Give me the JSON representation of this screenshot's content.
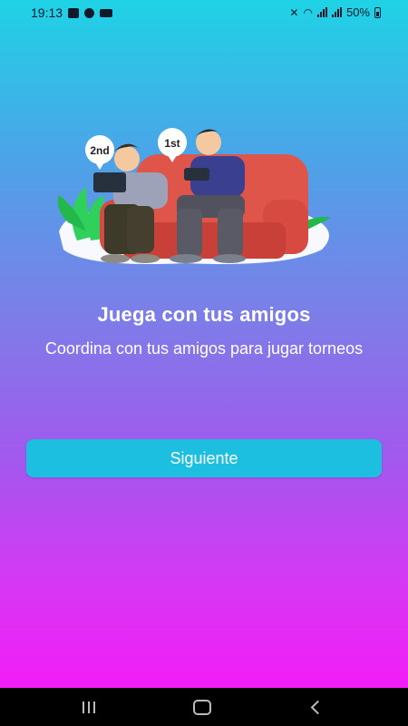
{
  "status_bar": {
    "time": "19:13",
    "battery": "50%",
    "left_icons": [
      "gallery-icon",
      "navigation-icon",
      "cast-icon"
    ],
    "right_icons": [
      "mute-icon",
      "wifi-icon",
      "signal-icon",
      "signal-icon",
      "battery-icon"
    ]
  },
  "onboarding": {
    "title": "Juega con tus amigos",
    "subtitle": "Coordina con tus amigos para jugar torneos",
    "illustration": {
      "badge_second": "2nd",
      "badge_first": "1st"
    },
    "next_button_label": "Siguiente"
  },
  "colors": {
    "gradient_top": "#1fd3e6",
    "gradient_bottom": "#f21df7",
    "button": "#1cbfe0"
  },
  "nav_bar": {
    "icons": [
      "recents-icon",
      "home-icon",
      "back-icon"
    ]
  }
}
